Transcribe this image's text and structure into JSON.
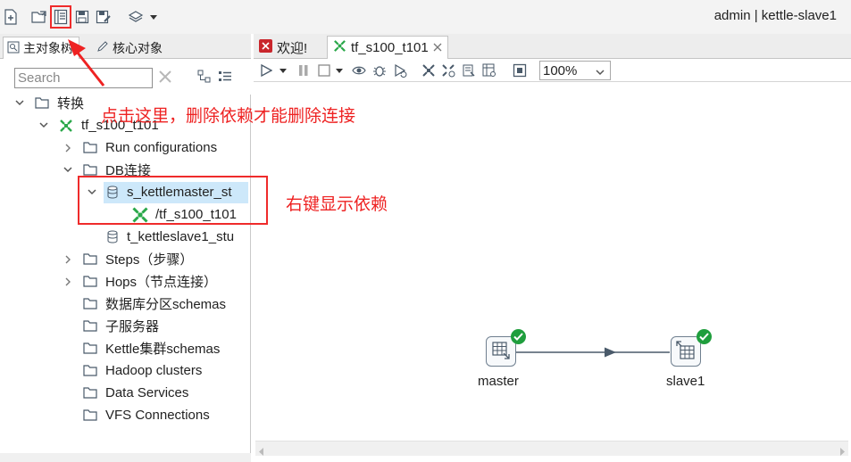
{
  "toolbar": {
    "user_info": "admin  |  kettle-slave1",
    "icons": [
      "new-file-icon",
      "open-folder-icon",
      "explore-repository-icon",
      "save-icon",
      "save-as-icon",
      "perspective-layers-icon",
      "dropdown-arrow-icon"
    ]
  },
  "left_panel": {
    "tabs": [
      {
        "label": "主对象树",
        "icon": "tree-icon",
        "active": true
      },
      {
        "label": "核心对象",
        "icon": "pencil-icon",
        "active": false
      }
    ],
    "search": {
      "placeholder": "Search",
      "value": ""
    },
    "tree": [
      {
        "label": "转换",
        "icon": "folder-icon",
        "expanded": true
      },
      {
        "label": "tf_s100_t101",
        "icon": "transformation-icon",
        "expanded": true
      },
      {
        "label": "Run configurations",
        "icon": "folder-icon",
        "expanded": false
      },
      {
        "label": "DB连接",
        "icon": "folder-icon",
        "expanded": true
      },
      {
        "label": "s_kettlemaster_st",
        "icon": "database-icon",
        "expanded": true,
        "selected": true
      },
      {
        "label": "/tf_s100_t101",
        "icon": "transformation-icon"
      },
      {
        "label": "t_kettleslave1_stu",
        "icon": "database-icon"
      },
      {
        "label": "Steps（步骤）",
        "icon": "folder-icon",
        "expanded": false
      },
      {
        "label": "Hops（节点连接）",
        "icon": "folder-icon",
        "expanded": false
      },
      {
        "label": "数据库分区schemas",
        "icon": "folder-icon"
      },
      {
        "label": "子服务器",
        "icon": "folder-icon"
      },
      {
        "label": "Kettle集群schemas",
        "icon": "folder-icon"
      },
      {
        "label": "Hadoop clusters",
        "icon": "folder-icon"
      },
      {
        "label": "Data Services",
        "icon": "folder-icon"
      },
      {
        "label": "VFS Connections",
        "icon": "folder-icon"
      }
    ]
  },
  "editor": {
    "tabs": [
      {
        "label": "欢迎!",
        "icon": "welcome-icon",
        "active": false
      },
      {
        "label": "tf_s100_t101",
        "icon": "transformation-icon",
        "active": true,
        "closable": true
      }
    ],
    "zoom": "100%",
    "steps": [
      {
        "label": "master",
        "icon": "table-input-icon",
        "status": "ok"
      },
      {
        "label": "slave1",
        "icon": "table-output-icon",
        "status": "ok"
      }
    ]
  },
  "annotations": {
    "note_toolbar": "点击这里，删除依赖才能删除连接",
    "note_tree": "右键显示依赖"
  },
  "colors": {
    "annotation": "#ee2222",
    "selection": "#cde8fa",
    "step_ok": "#1f9e3d",
    "hop": "#4a5a6a"
  }
}
